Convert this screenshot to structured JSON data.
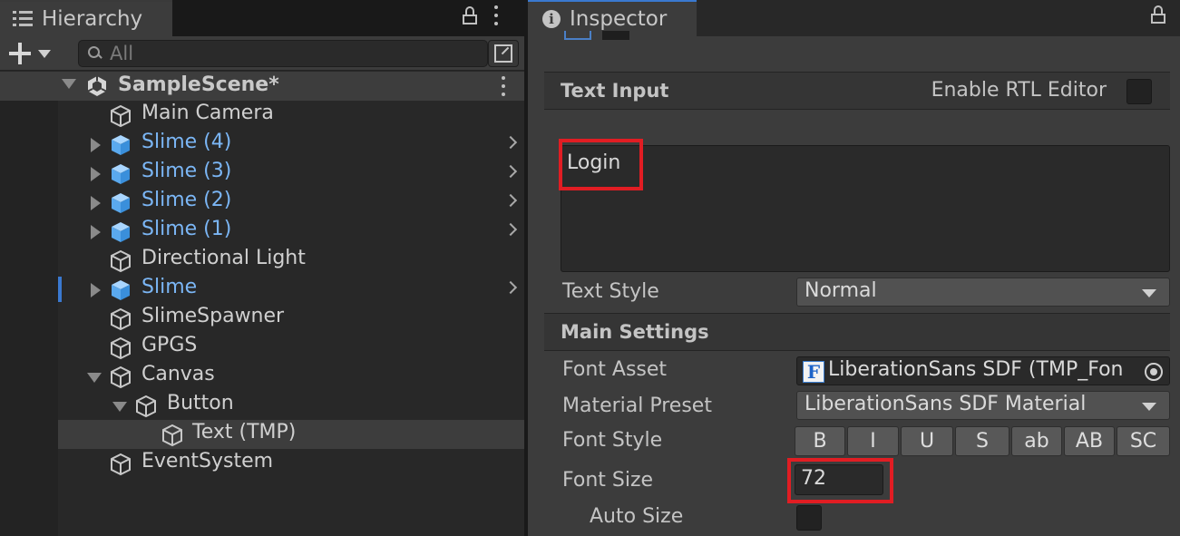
{
  "hierarchy": {
    "tab_title": "Hierarchy",
    "search_placeholder": "All",
    "scene_name": "SampleScene*",
    "items": [
      {
        "label": "Main Camera"
      },
      {
        "label": "Slime (4)"
      },
      {
        "label": "Slime (3)"
      },
      {
        "label": "Slime (2)"
      },
      {
        "label": "Slime (1)"
      },
      {
        "label": "Directional Light"
      },
      {
        "label": "Slime"
      },
      {
        "label": "SlimeSpawner"
      },
      {
        "label": "GPGS"
      },
      {
        "label": "Canvas"
      },
      {
        "label": "Button"
      },
      {
        "label": "Text (TMP)"
      },
      {
        "label": "EventSystem"
      }
    ]
  },
  "inspector": {
    "tab_title": "Inspector",
    "text_input": {
      "header": "Text Input",
      "rtl_label": "Enable RTL Editor",
      "text_value": "Login",
      "text_style_label": "Text Style",
      "text_style_value": "Normal"
    },
    "main_settings": {
      "header": "Main Settings",
      "font_asset_label": "Font Asset",
      "font_asset_value": "LiberationSans SDF (TMP_Fon",
      "material_preset_label": "Material Preset",
      "material_preset_value": "LiberationSans SDF Material",
      "font_style_label": "Font Style",
      "font_style_buttons": [
        "B",
        "I",
        "U",
        "S",
        "ab",
        "AB",
        "SC"
      ],
      "font_size_label": "Font Size",
      "font_size_value": "72",
      "auto_size_label": "Auto Size"
    }
  },
  "colors": {
    "prefab_text": "#7bb6f5",
    "selection_marker": "#3a79d0",
    "highlight_box": "#e11d23"
  }
}
